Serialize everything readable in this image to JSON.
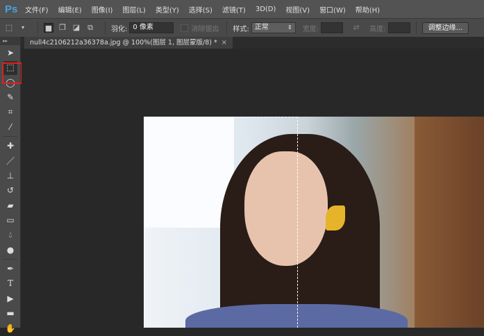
{
  "app": {
    "logo": "Ps"
  },
  "menu": [
    "文件(F)",
    "编辑(E)",
    "图像(I)",
    "图层(L)",
    "类型(Y)",
    "选择(S)",
    "滤镜(T)",
    "3D(D)",
    "视图(V)",
    "窗口(W)",
    "帮助(H)"
  ],
  "options": {
    "feather_label": "羽化:",
    "feather_value": "0 像素",
    "antialias_label": "消除锯齿",
    "style_label": "样式:",
    "style_value": "正常",
    "width_label": "宽度:",
    "height_label": "高度:",
    "refine_edge_button": "调整边缘..."
  },
  "document": {
    "tab_title": "null4c2106212a36378a.jpg @ 100%(图层 1, 图层蒙版/8) *",
    "close": "×"
  },
  "toolbox": {
    "selected_tool": "rectangular-marquee",
    "highlight_color": "#e0201c"
  }
}
